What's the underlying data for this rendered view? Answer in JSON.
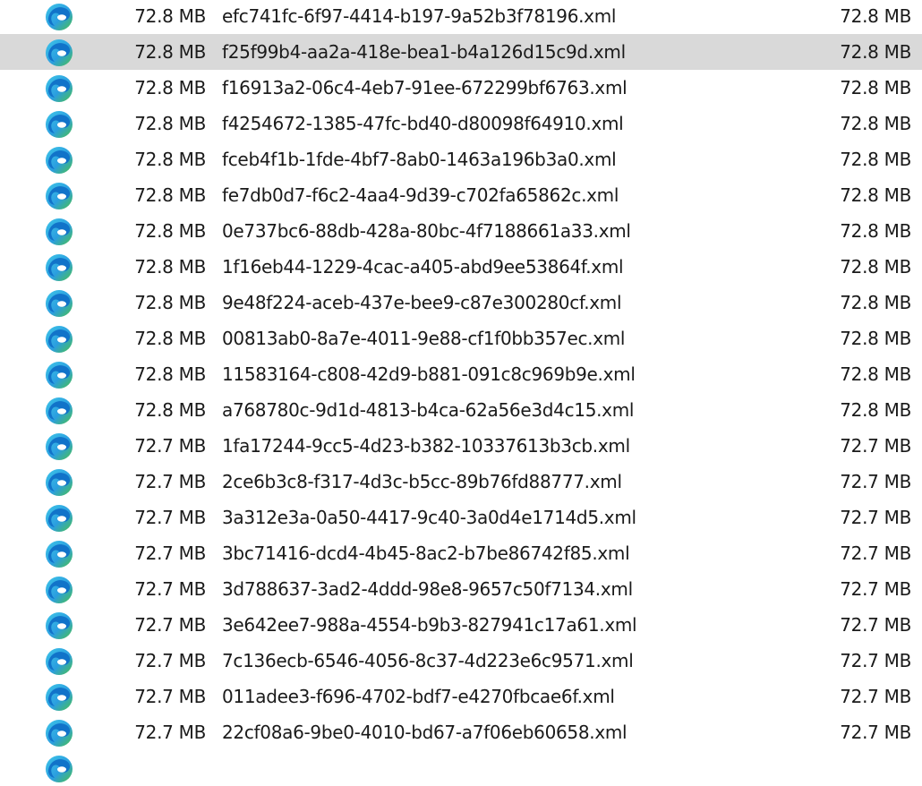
{
  "file_list": {
    "icon": "edge-xml-file-icon",
    "colors": {
      "selected_row": "#d9d9d9",
      "icon_blue": "#1173c9",
      "icon_cyan": "#3fc6e8",
      "icon_green": "#4cc24a"
    },
    "rows": [
      {
        "size": "72.8 MB",
        "name": "efc741fc-6f97-4414-b197-9a52b3f78196.xml",
        "size2": "72.8 MB",
        "selected": false
      },
      {
        "size": "72.8 MB",
        "name": "f25f99b4-aa2a-418e-bea1-b4a126d15c9d.xml",
        "size2": "72.8 MB",
        "selected": true
      },
      {
        "size": "72.8 MB",
        "name": "f16913a2-06c4-4eb7-91ee-672299bf6763.xml",
        "size2": "72.8 MB",
        "selected": false
      },
      {
        "size": "72.8 MB",
        "name": "f4254672-1385-47fc-bd40-d80098f64910.xml",
        "size2": "72.8 MB",
        "selected": false
      },
      {
        "size": "72.8 MB",
        "name": "fceb4f1b-1fde-4bf7-8ab0-1463a196b3a0.xml",
        "size2": "72.8 MB",
        "selected": false
      },
      {
        "size": "72.8 MB",
        "name": "fe7db0d7-f6c2-4aa4-9d39-c702fa65862c.xml",
        "size2": "72.8 MB",
        "selected": false
      },
      {
        "size": "72.8 MB",
        "name": "0e737bc6-88db-428a-80bc-4f7188661a33.xml",
        "size2": "72.8 MB",
        "selected": false
      },
      {
        "size": "72.8 MB",
        "name": "1f16eb44-1229-4cac-a405-abd9ee53864f.xml",
        "size2": "72.8 MB",
        "selected": false
      },
      {
        "size": "72.8 MB",
        "name": "9e48f224-aceb-437e-bee9-c87e300280cf.xml",
        "size2": "72.8 MB",
        "selected": false
      },
      {
        "size": "72.8 MB",
        "name": "00813ab0-8a7e-4011-9e88-cf1f0bb357ec.xml",
        "size2": "72.8 MB",
        "selected": false
      },
      {
        "size": "72.8 MB",
        "name": "11583164-c808-42d9-b881-091c8c969b9e.xml",
        "size2": "72.8 MB",
        "selected": false
      },
      {
        "size": "72.8 MB",
        "name": "a768780c-9d1d-4813-b4ca-62a56e3d4c15.xml",
        "size2": "72.8 MB",
        "selected": false
      },
      {
        "size": "72.7 MB",
        "name": "1fa17244-9cc5-4d23-b382-10337613b3cb.xml",
        "size2": "72.7 MB",
        "selected": false
      },
      {
        "size": "72.7 MB",
        "name": "2ce6b3c8-f317-4d3c-b5cc-89b76fd88777.xml",
        "size2": "72.7 MB",
        "selected": false
      },
      {
        "size": "72.7 MB",
        "name": "3a312e3a-0a50-4417-9c40-3a0d4e1714d5.xml",
        "size2": "72.7 MB",
        "selected": false
      },
      {
        "size": "72.7 MB",
        "name": "3bc71416-dcd4-4b45-8ac2-b7be86742f85.xml",
        "size2": "72.7 MB",
        "selected": false
      },
      {
        "size": "72.7 MB",
        "name": "3d788637-3ad2-4ddd-98e8-9657c50f7134.xml",
        "size2": "72.7 MB",
        "selected": false
      },
      {
        "size": "72.7 MB",
        "name": "3e642ee7-988a-4554-b9b3-827941c17a61.xml",
        "size2": "72.7 MB",
        "selected": false
      },
      {
        "size": "72.7 MB",
        "name": "7c136ecb-6546-4056-8c37-4d223e6c9571.xml",
        "size2": "72.7 MB",
        "selected": false
      },
      {
        "size": "72.7 MB",
        "name": "011adee3-f696-4702-bdf7-e4270fbcae6f.xml",
        "size2": "72.7 MB",
        "selected": false
      },
      {
        "size": "72.7 MB",
        "name": "22cf08a6-9be0-4010-bd67-a7f06eb60658.xml",
        "size2": "72.7 MB",
        "selected": false
      },
      {
        "size": "",
        "name": "",
        "size2": "",
        "selected": false
      }
    ]
  }
}
